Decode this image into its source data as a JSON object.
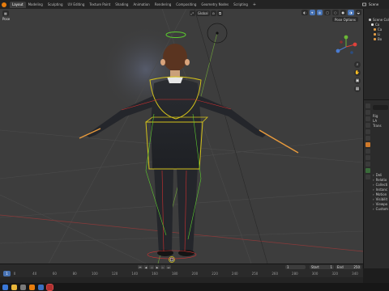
{
  "workspace_tabs": [
    "Layout",
    "Modeling",
    "Sculpting",
    "UV Editing",
    "Texture Paint",
    "Shading",
    "Animation",
    "Rendering",
    "Compositing",
    "Geometry Nodes",
    "Scripting"
  ],
  "active_tab_index": 0,
  "add_workspace_label": "+",
  "top_right": {
    "scene_label": "Scene"
  },
  "viewport": {
    "mode_label": "Pose",
    "transform_orientation": "Global",
    "pose_options_label": "Pose Options"
  },
  "outliner": {
    "rows": [
      "Scene Col",
      "Co",
      "Ca",
      "Li",
      "Bo"
    ]
  },
  "properties": {
    "rows_top": [
      "Rig",
      "LA",
      "Trans"
    ],
    "rows_bottom": [
      "Deli",
      "Relatio",
      "Collecti",
      "Instanc",
      "Motion",
      "Visibilit",
      "Viewpo",
      "Custom"
    ]
  },
  "timeline": {
    "current_frame": "1",
    "playhead_label": "1",
    "start_label": "Start",
    "start_value": "1",
    "end_label": "End",
    "end_value": "250",
    "ticks": [
      "0",
      "40",
      "60",
      "80",
      "100",
      "120",
      "140",
      "160",
      "180",
      "200",
      "220",
      "240",
      "250",
      "260",
      "280",
      "300",
      "320",
      "340"
    ]
  },
  "colors": {
    "accent": "#4772b3",
    "bone_outline": "#d4c21a",
    "bone_green": "#5ccc2e",
    "bone_red": "#d03030",
    "hand_bone": "#e89a3c",
    "viewport_bg": "#3d3d3d"
  },
  "icons": {
    "app_logo": "blender-logo",
    "nav": [
      "zoom-icon",
      "hand-pan-icon",
      "camera-view-icon",
      "perspective-grid-icon"
    ],
    "taskbar": [
      "start-icon",
      "file-explorer-icon",
      "settings-icon",
      "blender-app-icon",
      "mail-icon",
      "record-icon"
    ]
  }
}
